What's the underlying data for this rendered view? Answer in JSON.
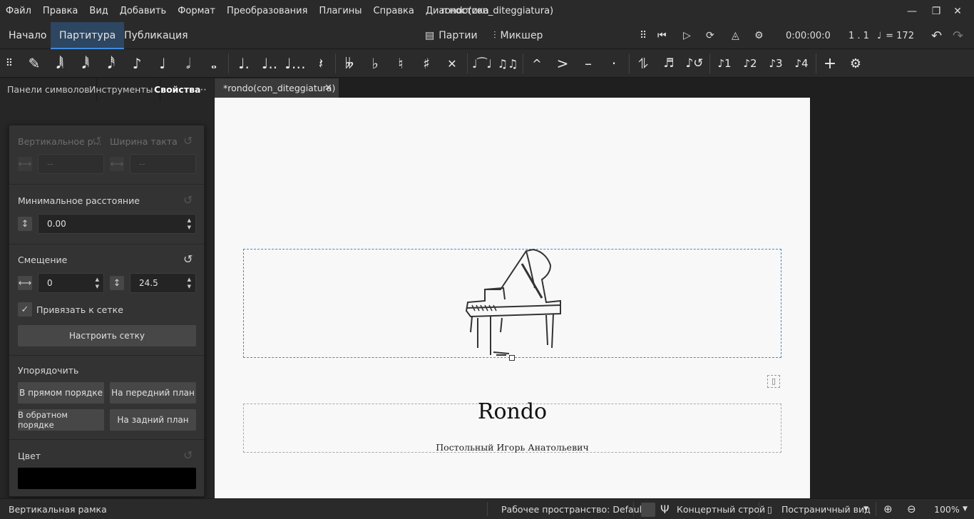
{
  "menu": [
    "Файл",
    "Правка",
    "Вид",
    "Добавить",
    "Формат",
    "Преобразования",
    "Плагины",
    "Справка",
    "Диагностика"
  ],
  "window_title": "rondo(con_diteggiatura)",
  "nav_tabs": [
    "Начало",
    "Партитура",
    "Публикация"
  ],
  "toolbar": {
    "parts_label": "Партии",
    "mixer_label": "Микшер",
    "time": "0:00:00:0",
    "position": "1 . 1",
    "tempo": "= 172"
  },
  "note_toolbar": {
    "voice_labels": [
      "1",
      "2",
      "3",
      "4"
    ]
  },
  "panel_tabs": [
    "Панели символов",
    "Инструменты",
    "Свойства"
  ],
  "doc_tab": "*rondo(con_diteggiatura)",
  "properties": {
    "vertical_label": "Вертикальное р...",
    "width_label": "Ширина такта",
    "vertical_value": "--",
    "width_value": "--",
    "min_distance_label": "Минимальное расстояние",
    "min_distance_value": "0.00",
    "offset_label": "Смещение",
    "offset_x": "0",
    "offset_y": "24.5",
    "snap_label": "Привязать к сетке",
    "grid_button": "Настроить сетку",
    "arrange_label": "Упорядочить",
    "forward_button": "В прямом порядке",
    "front_button": "На передний план",
    "backward_button": "В обратном порядке",
    "back_button": "На задний план",
    "color_label": "Цвет",
    "color_value": "#000000"
  },
  "score": {
    "title": "Rondo",
    "composer": "Постольный Игорь Анатольевич"
  },
  "status": {
    "selection": "Вертикальная рамка",
    "workspace": "Рабочее пространство: Default",
    "concert_pitch": "Концертный строй",
    "view_mode": "Постраничный вид",
    "zoom": "100%"
  },
  "colors": {
    "accent": "#3d8ce0",
    "active_tab": "#2d4662"
  }
}
